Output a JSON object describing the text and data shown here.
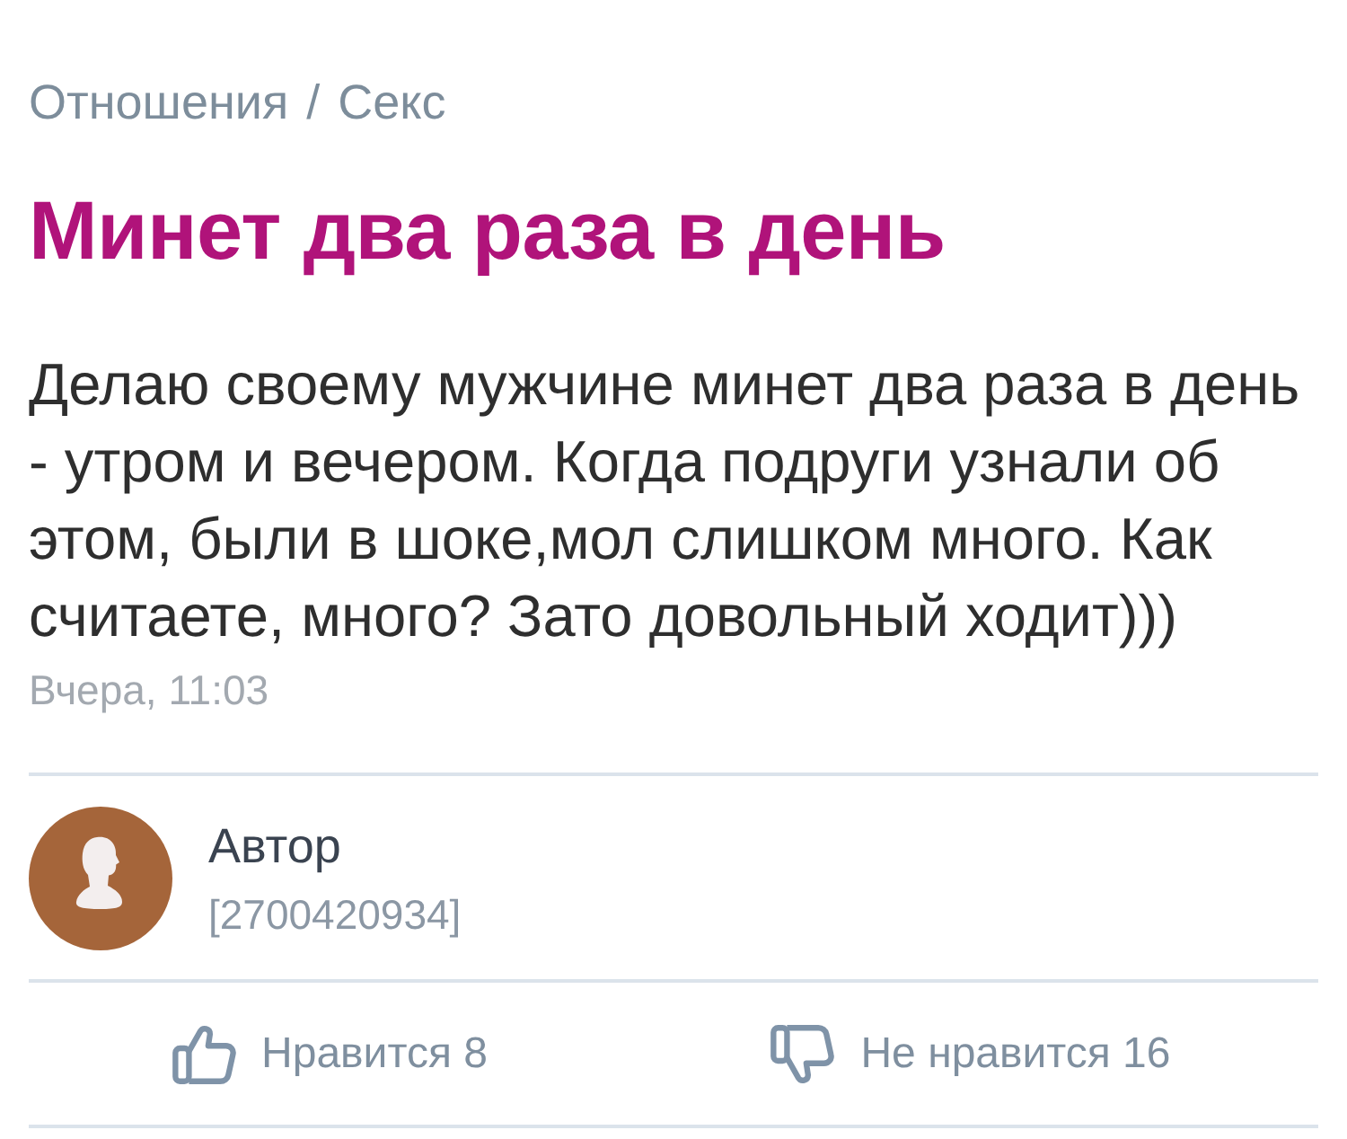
{
  "breadcrumb": {
    "items": [
      "Отношения",
      "Секс"
    ],
    "separator": "/"
  },
  "post": {
    "title": "Минет два раза в день",
    "body": "Делаю своему мужчине минет два раза в день - утром и вечером. Когда подруги узнали об этом, были в шоке,мол слишком много. Как считаете, много? Зато довольный ходит)))",
    "time": "Вчера, 11:03"
  },
  "author": {
    "name": "Автор",
    "id": "[2700420934]"
  },
  "reactions": [
    {
      "kind": "like",
      "label": "Нравится 8"
    },
    {
      "kind": "dislike",
      "label": "Не нравится 16"
    }
  ]
}
